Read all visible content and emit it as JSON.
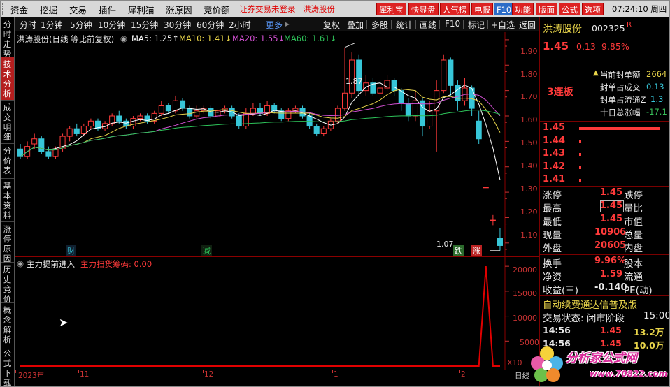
{
  "menu": {
    "items": [
      "资金",
      "挖掘",
      "交易",
      "插件",
      "犀利猫",
      "涨原因",
      "竞价额"
    ],
    "notice": "证券交易未登录",
    "stock_link": "洪涛股份",
    "buttons": [
      "犀利宝",
      "快显盘",
      "人气榜",
      "电报",
      "F10",
      "功能",
      "版面",
      "公式",
      "选项"
    ],
    "clock": "07:24:10 周四"
  },
  "left_tabs": [
    {
      "label": "分时走势",
      "active": false
    },
    {
      "label": "技术分析",
      "active": true
    },
    {
      "label": "成交明细",
      "active": false
    },
    {
      "label": "分价表",
      "active": false
    },
    {
      "label": "基本资料",
      "active": false
    },
    {
      "label": "涨停原因",
      "active": false
    },
    {
      "label": "历史竞价",
      "active": false
    },
    {
      "label": "概念解析",
      "active": false
    },
    {
      "label": "公式下载",
      "active": false
    }
  ],
  "toolbar": {
    "periods": [
      "分时",
      "1分钟",
      "5分钟",
      "10分钟",
      "15分钟",
      "30分钟",
      "60分钟",
      "2小时",
      "更多"
    ],
    "actions": [
      "复权",
      "叠加",
      "多股",
      "统计",
      "画线",
      "F10",
      "标记",
      "+自选",
      "返回"
    ]
  },
  "main_chart": {
    "title": "洪涛股份(日线 等比前复权)",
    "ma5": "MA5: 1.25↑",
    "ma10": "MA10: 1.41↓",
    "ma20": "MA20: 1.55↓",
    "ma60": "MA60: 1.61↓",
    "high_label": "1.87",
    "low_label": "1.07",
    "yticks": [
      "1.90",
      "1.80",
      "1.70",
      "1.60",
      "1.50",
      "1.40",
      "1.30",
      "1.20",
      "1.10"
    ],
    "markers": {
      "cai": "财",
      "jian": "减",
      "die": "跌",
      "zhang": "涨"
    },
    "colors": {
      "ma5": "#ffffff",
      "ma10": "#e8d44a",
      "ma20": "#d04fd0",
      "ma60": "#2ec45a",
      "up": "#ff3a3a",
      "down": "#37c6d8"
    }
  },
  "sub_chart": {
    "title": "主力提前进入",
    "indicator": "主力扫货筹码: 0.00",
    "yticks": [
      "20000",
      "15000",
      "10000",
      "5000"
    ],
    "unit": "X10"
  },
  "time_axis": {
    "labels": [
      "2023年",
      "11",
      "12",
      "1",
      "2"
    ],
    "right": "日线"
  },
  "chart_data": [
    {
      "type": "candlestick",
      "title": "洪涛股份(日线 等比前复权)",
      "ylim": [
        1.05,
        1.93
      ],
      "candles": [
        {
          "o": 1.47,
          "c": 1.44,
          "h": 1.49,
          "l": 1.43
        },
        {
          "o": 1.44,
          "c": 1.48,
          "h": 1.5,
          "l": 1.43
        },
        {
          "o": 1.49,
          "c": 1.51,
          "h": 1.53,
          "l": 1.47
        },
        {
          "o": 1.51,
          "c": 1.46,
          "h": 1.52,
          "l": 1.45
        },
        {
          "o": 1.46,
          "c": 1.44,
          "h": 1.48,
          "l": 1.43
        },
        {
          "o": 1.44,
          "c": 1.47,
          "h": 1.48,
          "l": 1.43
        },
        {
          "o": 1.47,
          "c": 1.52,
          "h": 1.53,
          "l": 1.46
        },
        {
          "o": 1.52,
          "c": 1.55,
          "h": 1.56,
          "l": 1.5
        },
        {
          "o": 1.55,
          "c": 1.53,
          "h": 1.57,
          "l": 1.52
        },
        {
          "o": 1.53,
          "c": 1.56,
          "h": 1.57,
          "l": 1.52
        },
        {
          "o": 1.56,
          "c": 1.58,
          "h": 1.59,
          "l": 1.55
        },
        {
          "o": 1.58,
          "c": 1.55,
          "h": 1.59,
          "l": 1.54
        },
        {
          "o": 1.55,
          "c": 1.57,
          "h": 1.58,
          "l": 1.54
        },
        {
          "o": 1.57,
          "c": 1.6,
          "h": 1.61,
          "l": 1.56
        },
        {
          "o": 1.6,
          "c": 1.58,
          "h": 1.62,
          "l": 1.57
        },
        {
          "o": 1.58,
          "c": 1.56,
          "h": 1.59,
          "l": 1.55
        },
        {
          "o": 1.56,
          "c": 1.59,
          "h": 1.6,
          "l": 1.55
        },
        {
          "o": 1.59,
          "c": 1.6,
          "h": 1.61,
          "l": 1.58
        },
        {
          "o": 1.6,
          "c": 1.58,
          "h": 1.61,
          "l": 1.57
        },
        {
          "o": 1.58,
          "c": 1.61,
          "h": 1.62,
          "l": 1.57
        },
        {
          "o": 1.61,
          "c": 1.64,
          "h": 1.66,
          "l": 1.6
        },
        {
          "o": 1.64,
          "c": 1.62,
          "h": 1.65,
          "l": 1.61
        },
        {
          "o": 1.62,
          "c": 1.66,
          "h": 1.68,
          "l": 1.61
        },
        {
          "o": 1.66,
          "c": 1.63,
          "h": 1.67,
          "l": 1.62
        },
        {
          "o": 1.63,
          "c": 1.6,
          "h": 1.64,
          "l": 1.59
        },
        {
          "o": 1.6,
          "c": 1.62,
          "h": 1.64,
          "l": 1.59
        },
        {
          "o": 1.62,
          "c": 1.63,
          "h": 1.64,
          "l": 1.61
        },
        {
          "o": 1.63,
          "c": 1.6,
          "h": 1.64,
          "l": 1.59
        },
        {
          "o": 1.6,
          "c": 1.62,
          "h": 1.63,
          "l": 1.59
        },
        {
          "o": 1.62,
          "c": 1.63,
          "h": 1.64,
          "l": 1.61
        },
        {
          "o": 1.63,
          "c": 1.6,
          "h": 1.64,
          "l": 1.59
        },
        {
          "o": 1.6,
          "c": 1.56,
          "h": 1.61,
          "l": 1.55
        },
        {
          "o": 1.56,
          "c": 1.61,
          "h": 1.63,
          "l": 1.55
        },
        {
          "o": 1.61,
          "c": 1.63,
          "h": 1.65,
          "l": 1.6
        },
        {
          "o": 1.63,
          "c": 1.61,
          "h": 1.65,
          "l": 1.6
        },
        {
          "o": 1.61,
          "c": 1.64,
          "h": 1.66,
          "l": 1.6
        },
        {
          "o": 1.64,
          "c": 1.62,
          "h": 1.65,
          "l": 1.61
        },
        {
          "o": 1.62,
          "c": 1.59,
          "h": 1.63,
          "l": 1.58
        },
        {
          "o": 1.59,
          "c": 1.62,
          "h": 1.63,
          "l": 1.58
        },
        {
          "o": 1.62,
          "c": 1.63,
          "h": 1.64,
          "l": 1.61
        },
        {
          "o": 1.63,
          "c": 1.6,
          "h": 1.64,
          "l": 1.59
        },
        {
          "o": 1.6,
          "c": 1.56,
          "h": 1.61,
          "l": 1.55
        },
        {
          "o": 1.56,
          "c": 1.53,
          "h": 1.57,
          "l": 1.52
        },
        {
          "o": 1.53,
          "c": 1.55,
          "h": 1.56,
          "l": 1.52
        },
        {
          "o": 1.55,
          "c": 1.58,
          "h": 1.59,
          "l": 1.54
        },
        {
          "o": 1.58,
          "c": 1.63,
          "h": 1.64,
          "l": 1.57
        },
        {
          "o": 1.63,
          "c": 1.69,
          "h": 1.87,
          "l": 1.62
        },
        {
          "o": 1.69,
          "c": 1.82,
          "h": 1.85,
          "l": 1.67
        },
        {
          "o": 1.82,
          "c": 1.7,
          "h": 1.84,
          "l": 1.68
        },
        {
          "o": 1.7,
          "c": 1.73,
          "h": 1.76,
          "l": 1.68
        },
        {
          "o": 1.73,
          "c": 1.69,
          "h": 1.75,
          "l": 1.68
        },
        {
          "o": 1.69,
          "c": 1.71,
          "h": 1.73,
          "l": 1.67
        },
        {
          "o": 1.71,
          "c": 1.74,
          "h": 1.76,
          "l": 1.7
        },
        {
          "o": 1.74,
          "c": 1.7,
          "h": 1.75,
          "l": 1.68
        },
        {
          "o": 1.7,
          "c": 1.65,
          "h": 1.71,
          "l": 1.62
        },
        {
          "o": 1.65,
          "c": 1.6,
          "h": 1.67,
          "l": 1.58
        },
        {
          "o": 1.6,
          "c": 1.66,
          "h": 1.7,
          "l": 1.58
        },
        {
          "o": 1.66,
          "c": 1.56,
          "h": 1.67,
          "l": 1.52
        },
        {
          "o": 1.56,
          "c": 1.62,
          "h": 1.66,
          "l": 1.55
        },
        {
          "o": 1.62,
          "c": 1.7,
          "h": 1.74,
          "l": 1.46
        },
        {
          "o": 1.7,
          "c": 1.82,
          "h": 1.84,
          "l": 1.69
        },
        {
          "o": 1.82,
          "c": 1.72,
          "h": 1.83,
          "l": 1.68
        },
        {
          "o": 1.72,
          "c": 1.66,
          "h": 1.74,
          "l": 1.62
        },
        {
          "o": 1.66,
          "c": 1.71,
          "h": 1.75,
          "l": 1.64
        },
        {
          "o": 1.71,
          "c": 1.63,
          "h": 1.72,
          "l": 1.6
        },
        {
          "o": 1.58,
          "c": 1.51,
          "h": 1.62,
          "l": 1.49
        },
        {
          "o": 1.32,
          "c": 1.32,
          "h": 1.32,
          "l": 1.32
        },
        {
          "o": 1.19,
          "c": 1.19,
          "h": 1.21,
          "l": 1.17
        },
        {
          "o": 1.12,
          "c": 1.09,
          "h": 1.16,
          "l": 1.07
        }
      ]
    },
    {
      "type": "line",
      "title": "主力提前进入",
      "ylim": [
        0,
        21000
      ],
      "series": [
        {
          "name": "主力扫货筹码",
          "values": [
            0,
            0,
            0,
            0,
            0,
            0,
            0,
            0,
            0,
            0,
            0,
            0,
            0,
            0,
            0,
            0,
            0,
            0,
            0,
            0,
            0,
            0,
            0,
            0,
            0,
            0,
            0,
            0,
            0,
            0,
            0,
            0,
            0,
            0,
            0,
            0,
            0,
            0,
            0,
            0,
            0,
            0,
            0,
            0,
            0,
            0,
            0,
            0,
            0,
            0,
            0,
            0,
            0,
            0,
            0,
            0,
            0,
            0,
            0,
            0,
            0,
            0,
            0,
            0,
            0,
            0,
            20000,
            0,
            0
          ]
        }
      ]
    }
  ],
  "quote": {
    "name": "洪涛股份",
    "code": "002325",
    "flag": "R",
    "price": "1.45",
    "change": "0.13",
    "pct": "9.85%",
    "streak": "3连板",
    "seal_rows": [
      {
        "label": "当前封单额",
        "value": "2664"
      },
      {
        "label": "封单占成交",
        "value": "0.13"
      },
      {
        "label": "封单占流通Z",
        "value": "1.3"
      },
      {
        "label": "十日总涨幅",
        "value": "-17.1"
      }
    ],
    "order_book": [
      {
        "price": "1.45",
        "bar": 1.0
      },
      {
        "price": "1.44",
        "bar": 0.02
      },
      {
        "price": "1.43",
        "bar": 0.02
      },
      {
        "price": "1.42",
        "bar": 0.02
      },
      {
        "price": "1.41",
        "bar": 0.02
      }
    ],
    "stats": [
      {
        "l": "涨停",
        "v": "1.45",
        "r": "跌停"
      },
      {
        "l": "最高",
        "v": "1.45",
        "r": "量比"
      },
      {
        "l": "最低",
        "v": "1.45",
        "r": "市值"
      },
      {
        "l": "现量",
        "v": "10906",
        "r": "总量"
      },
      {
        "l": "外盘",
        "v": "20605",
        "r": "内盘"
      }
    ],
    "fund": [
      {
        "l": "换手",
        "v": "9.96%",
        "r": "股本"
      },
      {
        "l": "净资",
        "v": "1.59",
        "r": "流通"
      },
      {
        "l": "收益(三)",
        "v": "-0.140",
        "r": "PE(动)"
      }
    ],
    "scroll_notice": "自动续费通达信普及版",
    "trade_status": "交易状态: 闭市阶段",
    "trade_time": "15:00",
    "ticks": [
      {
        "t": "14:56",
        "p": "1.45",
        "v": "13.2万"
      },
      {
        "t": "14:56",
        "p": "1.45",
        "v": "10.0万"
      }
    ]
  },
  "watermark": {
    "text": "分析家公式网",
    "url": "www.70822.com"
  }
}
